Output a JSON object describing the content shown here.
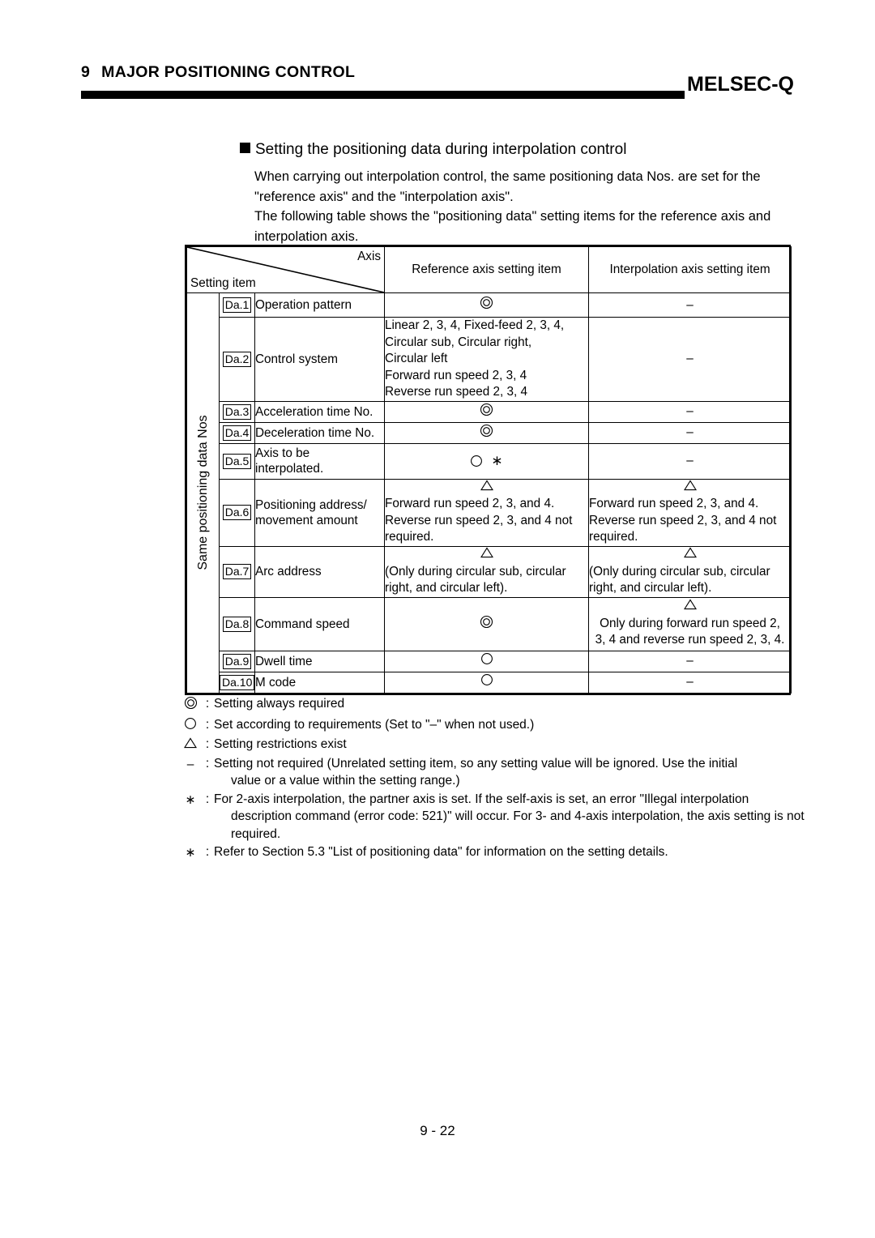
{
  "header": {
    "chapter_number": "9",
    "chapter_title": "MAJOR POSITIONING CONTROL",
    "brand": "MELSEC-Q"
  },
  "section": {
    "heading": "Setting the positioning data during interpolation control",
    "paragraph1": "When carrying out interpolation control, the same positioning data Nos. are set for the \"reference axis\" and the \"interpolation axis\".",
    "paragraph2": "The following table shows the \"positioning data\" setting items for the reference axis and interpolation axis."
  },
  "table": {
    "corner": {
      "axis_label": "Axis",
      "setting_item_label": "Setting item"
    },
    "columns": {
      "reference": "Reference axis setting item",
      "interpolation": "Interpolation axis setting item"
    },
    "band_label": "Same positioning data Nos",
    "rows": [
      {
        "da": "Da.1",
        "item": "Operation pattern",
        "ref_symbol": "double-circle",
        "ref_text": "",
        "int_symbol": "dash",
        "int_text": ""
      },
      {
        "da": "Da.2",
        "item": "Control system",
        "ref_symbol": "none",
        "ref_text": "Linear 2, 3, 4, Fixed-feed 2, 3, 4,\nCircular sub, Circular right,\nCircular left\nForward run speed 2, 3, 4\nReverse run speed 2, 3, 4",
        "int_symbol": "dash",
        "int_text": ""
      },
      {
        "da": "Da.3",
        "item": "Acceleration time No.",
        "ref_symbol": "double-circle",
        "ref_text": "",
        "int_symbol": "dash",
        "int_text": ""
      },
      {
        "da": "Da.4",
        "item": "Deceleration time No.",
        "ref_symbol": "double-circle",
        "ref_text": "",
        "int_symbol": "dash",
        "int_text": ""
      },
      {
        "da": "Da.5",
        "item": "Axis to be\ninterpolated.",
        "ref_symbol": "circle-asterisk",
        "ref_text": "",
        "int_symbol": "dash",
        "int_text": ""
      },
      {
        "da": "Da.6",
        "item": "Positioning address/\nmovement amount",
        "ref_symbol": "triangle",
        "ref_text": "Forward run speed 2, 3, and 4.\nReverse run speed 2, 3, and 4 not\nrequired.",
        "int_symbol": "triangle",
        "int_text": "Forward run speed 2, 3, and 4.\nReverse run speed 2, 3, and 4 not\nrequired."
      },
      {
        "da": "Da.7",
        "item": "Arc address",
        "ref_symbol": "triangle",
        "ref_text": "(Only during circular sub, circular\nright, and circular left).",
        "int_symbol": "triangle",
        "int_text": "(Only during circular sub, circular\nright, and circular left)."
      },
      {
        "da": "Da.8",
        "item": "Command speed",
        "ref_symbol": "double-circle",
        "ref_text": "",
        "int_symbol": "triangle",
        "int_text": "Only during forward run speed 2,\n3, 4 and reverse run speed 2, 3, 4."
      },
      {
        "da": "Da.9",
        "item": "Dwell time",
        "ref_symbol": "circle",
        "ref_text": "",
        "int_symbol": "dash",
        "int_text": ""
      },
      {
        "da": "Da.10",
        "item": "M code",
        "ref_symbol": "circle",
        "ref_text": "",
        "int_symbol": "dash",
        "int_text": ""
      }
    ]
  },
  "legend": [
    {
      "symbol": "double-circle",
      "colon": ":",
      "text": "Setting always required",
      "continuation": ""
    },
    {
      "symbol": "circle",
      "colon": ":",
      "text": "Set according to requirements (Set to \"–\" when not used.)",
      "continuation": ""
    },
    {
      "symbol": "triangle",
      "colon": ":",
      "text": "Setting restrictions exist",
      "continuation": ""
    },
    {
      "symbol": "dash",
      "colon": ":",
      "text": "Setting not required (Unrelated setting item, so any setting value will be ignored. Use the initial",
      "continuation": "value or a value within the setting range.)"
    },
    {
      "symbol": "asterisk",
      "colon": ":",
      "text": "For 2-axis interpolation, the partner axis is set.  If the self-axis is set, an error \"Illegal interpolation",
      "continuation": "description command (error code: 521)\" will occur.  For 3- and 4-axis interpolation, the axis setting is not required."
    },
    {
      "symbol": "asterisk",
      "colon": ":",
      "text": "Refer to Section 5.3 \"List of positioning data\" for information on the setting details.",
      "continuation": ""
    }
  ],
  "footer": {
    "page_number": "9 - 22"
  }
}
